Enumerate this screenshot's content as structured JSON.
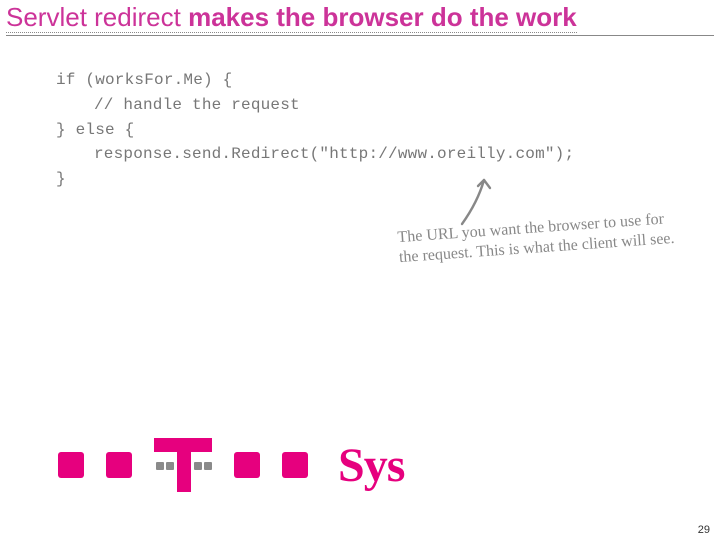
{
  "title": {
    "part1": "Servlet redirect ",
    "part2": "makes the browser do the work"
  },
  "code": {
    "l1": "if (worksFor.Me) {",
    "l2": "// handle the request",
    "l3": "} else {",
    "l4": "response.send.Redirect(\"http://www.oreilly.com\");",
    "l5": "}"
  },
  "annotation": "The URL you want the browser to use for the request. This is what the client will see.",
  "logo_word": "Sys",
  "page_number": "29",
  "colors": {
    "accent": "#cc3399",
    "brand": "#e6007e"
  }
}
